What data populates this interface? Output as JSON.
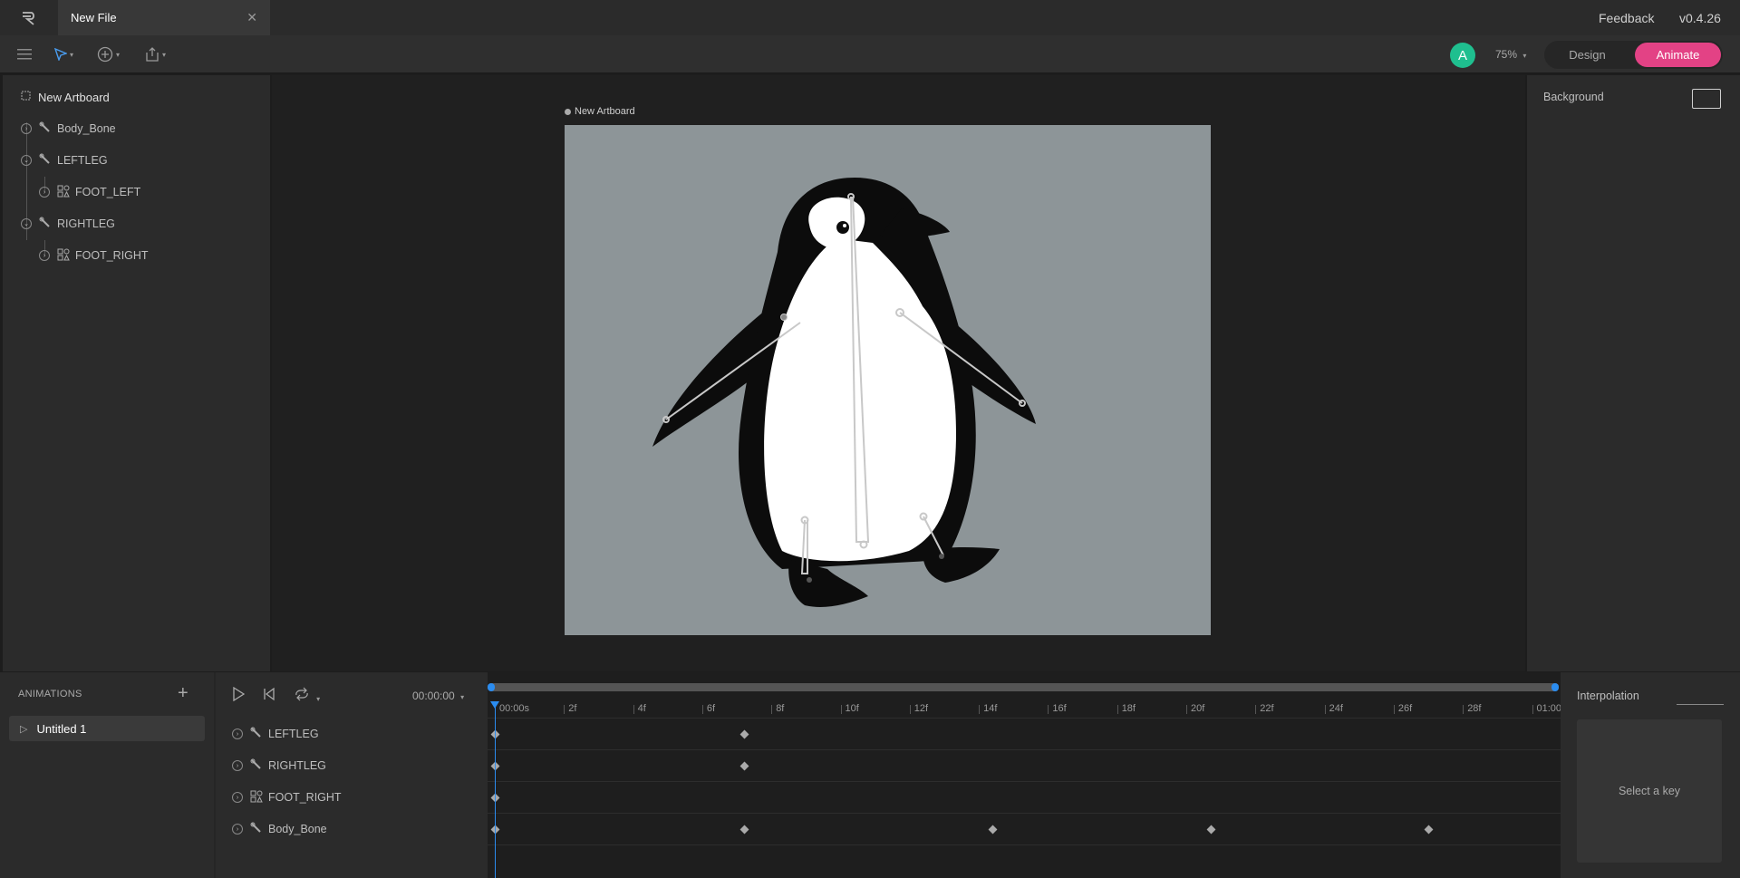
{
  "titlebar": {
    "tab_title": "New File",
    "close_glyph": "✕",
    "feedback_label": "Feedback",
    "version": "v0.4.26"
  },
  "toolbar": {
    "avatar_letter": "A",
    "zoom": "75%",
    "design_label": "Design",
    "animate_label": "Animate",
    "accent_color": "#e34285"
  },
  "hierarchy": {
    "artboard": "New Artboard",
    "items": [
      {
        "label": "Body_Bone",
        "icon": "bone-icon"
      },
      {
        "label": "LEFTLEG",
        "icon": "bone-icon"
      },
      {
        "label": "FOOT_LEFT",
        "icon": "shapes-icon"
      },
      {
        "label": "RIGHTLEG",
        "icon": "bone-icon"
      },
      {
        "label": "FOOT_RIGHT",
        "icon": "shapes-icon"
      }
    ]
  },
  "stage": {
    "artboard_label": "New Artboard",
    "artboard_color": "#8d9598"
  },
  "inspector": {
    "background_label": "Background"
  },
  "animations": {
    "title": "ANIMATIONS",
    "add_glyph": "+",
    "items": [
      "Untitled 1"
    ]
  },
  "timeline": {
    "time": "00:00:00",
    "ticks": [
      "00:00s",
      "2f",
      "4f",
      "6f",
      "8f",
      "10f",
      "12f",
      "14f",
      "16f",
      "18f",
      "20f",
      "22f",
      "24f",
      "26f",
      "28f",
      "01:00"
    ],
    "tracks": [
      {
        "label": "LEFTLEG",
        "icon": "bone-icon",
        "keys_frames": [
          0,
          8
        ]
      },
      {
        "label": "RIGHTLEG",
        "icon": "bone-icon",
        "keys_frames": [
          0,
          8
        ]
      },
      {
        "label": "FOOT_RIGHT",
        "icon": "shapes-icon",
        "keys_frames": [
          0
        ]
      },
      {
        "label": "Body_Bone",
        "icon": "bone-icon",
        "keys_frames": [
          0,
          8,
          16,
          23,
          30
        ]
      }
    ]
  },
  "interpolation": {
    "title": "Interpolation",
    "hint": "Select a key"
  }
}
